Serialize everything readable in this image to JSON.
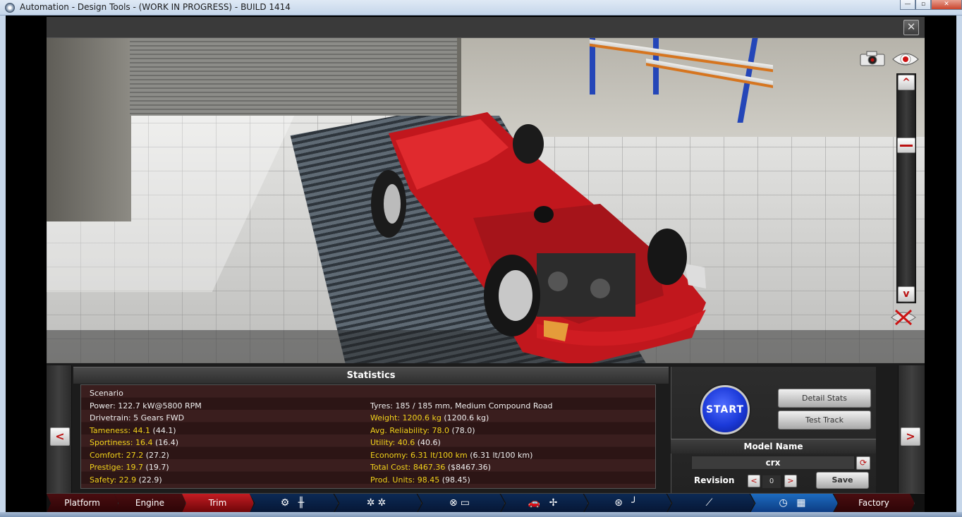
{
  "window": {
    "title": "Automation - Design Tools - (WORK IN PROGRESS) - BUILD 1414",
    "controls": {
      "minimize": "—",
      "maximize": "▫",
      "close": "✕"
    },
    "close_overlay": "✕"
  },
  "viewport": {
    "zoom_up": "^",
    "zoom_down": "v"
  },
  "statistics": {
    "title": "Statistics",
    "left_column": [
      {
        "text": "Scenario",
        "highlight": false
      },
      {
        "text": "Power: 122.7 kW@5800 RPM",
        "highlight": false
      },
      {
        "text": "Drivetrain: 5 Gears FWD",
        "highlight": false
      },
      {
        "label": "Tameness: 44.1",
        "extra": " (44.1)",
        "highlight": true
      },
      {
        "label": "Sportiness: 16.4",
        "extra": " (16.4)",
        "highlight": true
      },
      {
        "label": "Comfort: 27.2",
        "extra": " (27.2)",
        "highlight": true
      },
      {
        "label": "Prestige: 19.7",
        "extra": " (19.7)",
        "highlight": true
      },
      {
        "label": "Safety: 22.9",
        "extra": " (22.9)",
        "highlight": true
      }
    ],
    "right_column": [
      {
        "text": "",
        "highlight": false
      },
      {
        "text": "Tyres: 185 / 185 mm, Medium Compound Road",
        "highlight": false
      },
      {
        "label": "Weight: 1200.6 kg",
        "extra": " (1200.6 kg)",
        "highlight": true
      },
      {
        "label": "Avg. Reliability: 78.0",
        "extra": " (78.0)",
        "highlight": true
      },
      {
        "label": "Utility: 40.6",
        "extra": " (40.6)",
        "highlight": true
      },
      {
        "label": "Economy: 6.31 lt/100 km",
        "extra": " (6.31 lt/100 km)",
        "highlight": true
      },
      {
        "label": "Total Cost: 8467.36",
        "extra": " ($8467.36)",
        "highlight": true
      },
      {
        "label": "Prod. Units: 98.45",
        "extra": " (98.45)",
        "highlight": true
      }
    ],
    "prev_arrow": "<",
    "next_arrow": ">"
  },
  "actions": {
    "start_label": "START",
    "detail_stats_label": "Detail Stats",
    "test_track_label": "Test Track",
    "model_name_header": "Model Name",
    "model_name_value": "crx",
    "revision_label": "Revision",
    "revision_value": "0",
    "revision_dec": "<",
    "revision_inc": ">",
    "save_label": "Save"
  },
  "navigation": {
    "items": [
      {
        "label": "Platform",
        "style": "red"
      },
      {
        "label": "Engine",
        "style": "red"
      },
      {
        "label": "Trim",
        "style": "active"
      },
      {
        "label": "",
        "icon": "engine-gearbox-icon",
        "glyph": "⚙ ╫",
        "style": "blue"
      },
      {
        "label": "",
        "icon": "wheels-icon",
        "glyph": "✲✲",
        "style": "blue"
      },
      {
        "label": "",
        "icon": "suspension-icon",
        "glyph": "⊗▭",
        "style": "blue"
      },
      {
        "label": "",
        "icon": "body-aero-icon",
        "glyph": "🚗 ✢",
        "style": "blue"
      },
      {
        "label": "",
        "icon": "interior-steering-icon",
        "glyph": "⊛ ╯",
        "style": "blue"
      },
      {
        "label": "",
        "icon": "exhaust-icon",
        "glyph": "⟋",
        "style": "blue"
      },
      {
        "label": "",
        "icon": "test-flag-icon",
        "glyph": "◷ ▦",
        "style": "blue-active"
      },
      {
        "label": "Factory",
        "style": "red"
      }
    ]
  },
  "colors": {
    "highlight_text": "#f2d21b",
    "start_button": "#1b39d8",
    "active_tab": "#c41c22"
  }
}
